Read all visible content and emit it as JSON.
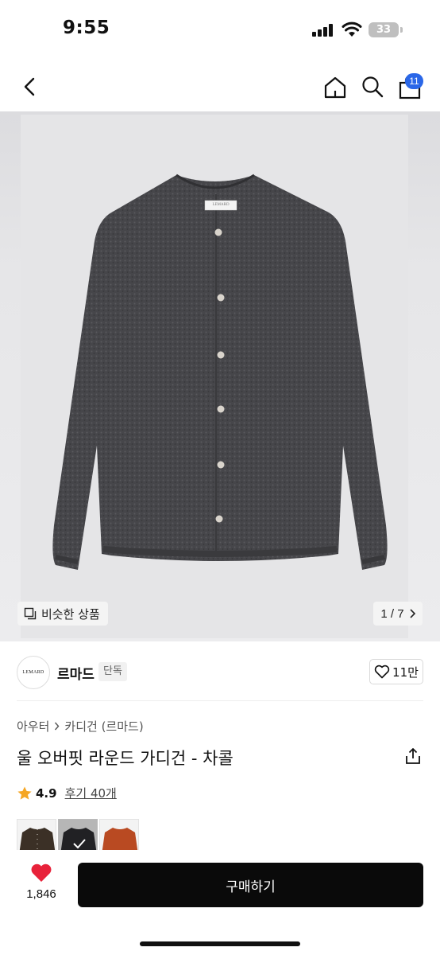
{
  "status": {
    "time": "9:55",
    "battery": "33"
  },
  "nav": {
    "cart_count": "11"
  },
  "gallery": {
    "similar_label": "비슷한 상품",
    "page": "1 / 7",
    "label_text": "LEMARD"
  },
  "brand": {
    "logo_text": "LEMARD",
    "name": "르마드",
    "tag": "단독",
    "likes": "11만"
  },
  "product": {
    "breadcrumb": [
      "아우터",
      "카디건 (르마드)"
    ],
    "title": "울 오버핏 라운드 가디건 - 차콜",
    "rating": "4.9",
    "reviews": "후기 40개"
  },
  "swatches": [
    {
      "name": "brown",
      "color": "#3b3026",
      "selected": false
    },
    {
      "name": "charcoal",
      "color": "#2d2d30",
      "selected": true
    },
    {
      "name": "orange",
      "color": "#b94a22",
      "selected": false
    }
  ],
  "bottom": {
    "wish_count": "1,846",
    "buy_label": "구매하기"
  },
  "colors": {
    "accent": "#2a67e8",
    "heart": "#e8223a",
    "star": "#f5a623",
    "cardigan": "#454548"
  }
}
